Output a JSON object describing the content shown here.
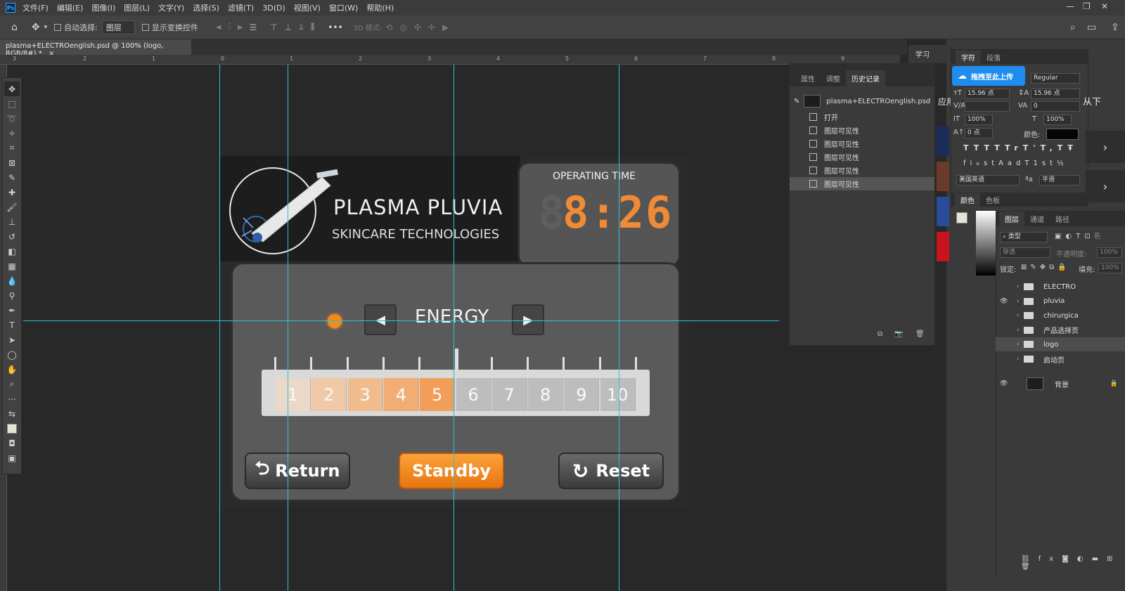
{
  "app": {
    "logo": "Ps",
    "menu": [
      "文件(F)",
      "编辑(E)",
      "图像(I)",
      "图层(L)",
      "文字(Y)",
      "选择(S)",
      "滤镜(T)",
      "3D(D)",
      "视图(V)",
      "窗口(W)",
      "帮助(H)"
    ]
  },
  "options": {
    "auto_select_label": "自动选择:",
    "auto_select_value": "图层",
    "show_transform_label": "显示变换控件",
    "mode_3d_label": "3D 模式:",
    "more": "•••"
  },
  "document_tab": {
    "title": "plasma+ELECTROenglish.psd @ 100% (logo, RGB/8#) *",
    "close": "×"
  },
  "ruler": {
    "marks": [
      "3",
      "2",
      "1",
      "0",
      "1",
      "2",
      "3",
      "4",
      "5",
      "6",
      "7",
      "8",
      "9"
    ]
  },
  "artwork": {
    "brand_title": "PLASMA PLUVIA",
    "brand_subtitle": "SKINCARE TECHNOLOGIES",
    "operating_time_label": "OPERATING TIME",
    "operating_time_value": "8:26",
    "operating_time_ghost": "8",
    "energy_label": "ENERGY",
    "energy_level": 5,
    "scale_values": [
      "1",
      "2",
      "3",
      "4",
      "5",
      "6",
      "7",
      "8",
      "9",
      "10"
    ],
    "return_label": "Return",
    "standby_label": "Standby",
    "reset_label": "Reset",
    "active_color": "#f08a1c"
  },
  "history_panel": {
    "tabs": [
      "属性",
      "调整",
      "历史记录"
    ],
    "snapshot": "plasma+ELECTROenglish.psd",
    "items": [
      "打开",
      "图层可见性",
      "图层可见性",
      "图层可见性",
      "图层可见性",
      "图层可见性"
    ]
  },
  "learn_tab": "学习",
  "character_panel": {
    "tabs": [
      "字符",
      "段落"
    ],
    "upload_label": "拖拽至此上传",
    "font_style": "Regular",
    "font_size": "15.96 点",
    "leading": "15.96 点",
    "tracking": "0",
    "vertical_scale": "100%",
    "horizontal_scale": "100%",
    "baseline_shift": "0 点",
    "color_label": "颜色:",
    "language": "美国英语",
    "antialias": "平滑",
    "style_buttons": [
      "T",
      "T",
      "TT",
      "Tr",
      "T'",
      "T,",
      "T",
      "Ŧ"
    ],
    "opentype_buttons": [
      "fi",
      "ℴ",
      "st",
      "A",
      "ad",
      "T",
      "1st",
      "½"
    ]
  },
  "color_panel": {
    "tabs": [
      "颜色",
      "色板"
    ]
  },
  "layers_panel": {
    "tabs": [
      "图层",
      "通道",
      "路径"
    ],
    "filter_label": "类型",
    "blend_mode": "穿透",
    "opacity_label": "不透明度:",
    "opacity_value": "100%",
    "lock_label": "锁定:",
    "fill_label": "填充:",
    "fill_value": "100%",
    "layers": [
      {
        "name": "ELECTRO",
        "visible": false
      },
      {
        "name": "pluvia",
        "visible": true
      },
      {
        "name": "chirurgica",
        "visible": false
      },
      {
        "name": "产品选择页",
        "visible": false
      },
      {
        "name": "logo",
        "visible": false
      },
      {
        "name": "启动页",
        "visible": false
      }
    ],
    "background_layer": "背景"
  },
  "right_edge": {
    "apply_text": "应用",
    "below_text": "从下"
  }
}
